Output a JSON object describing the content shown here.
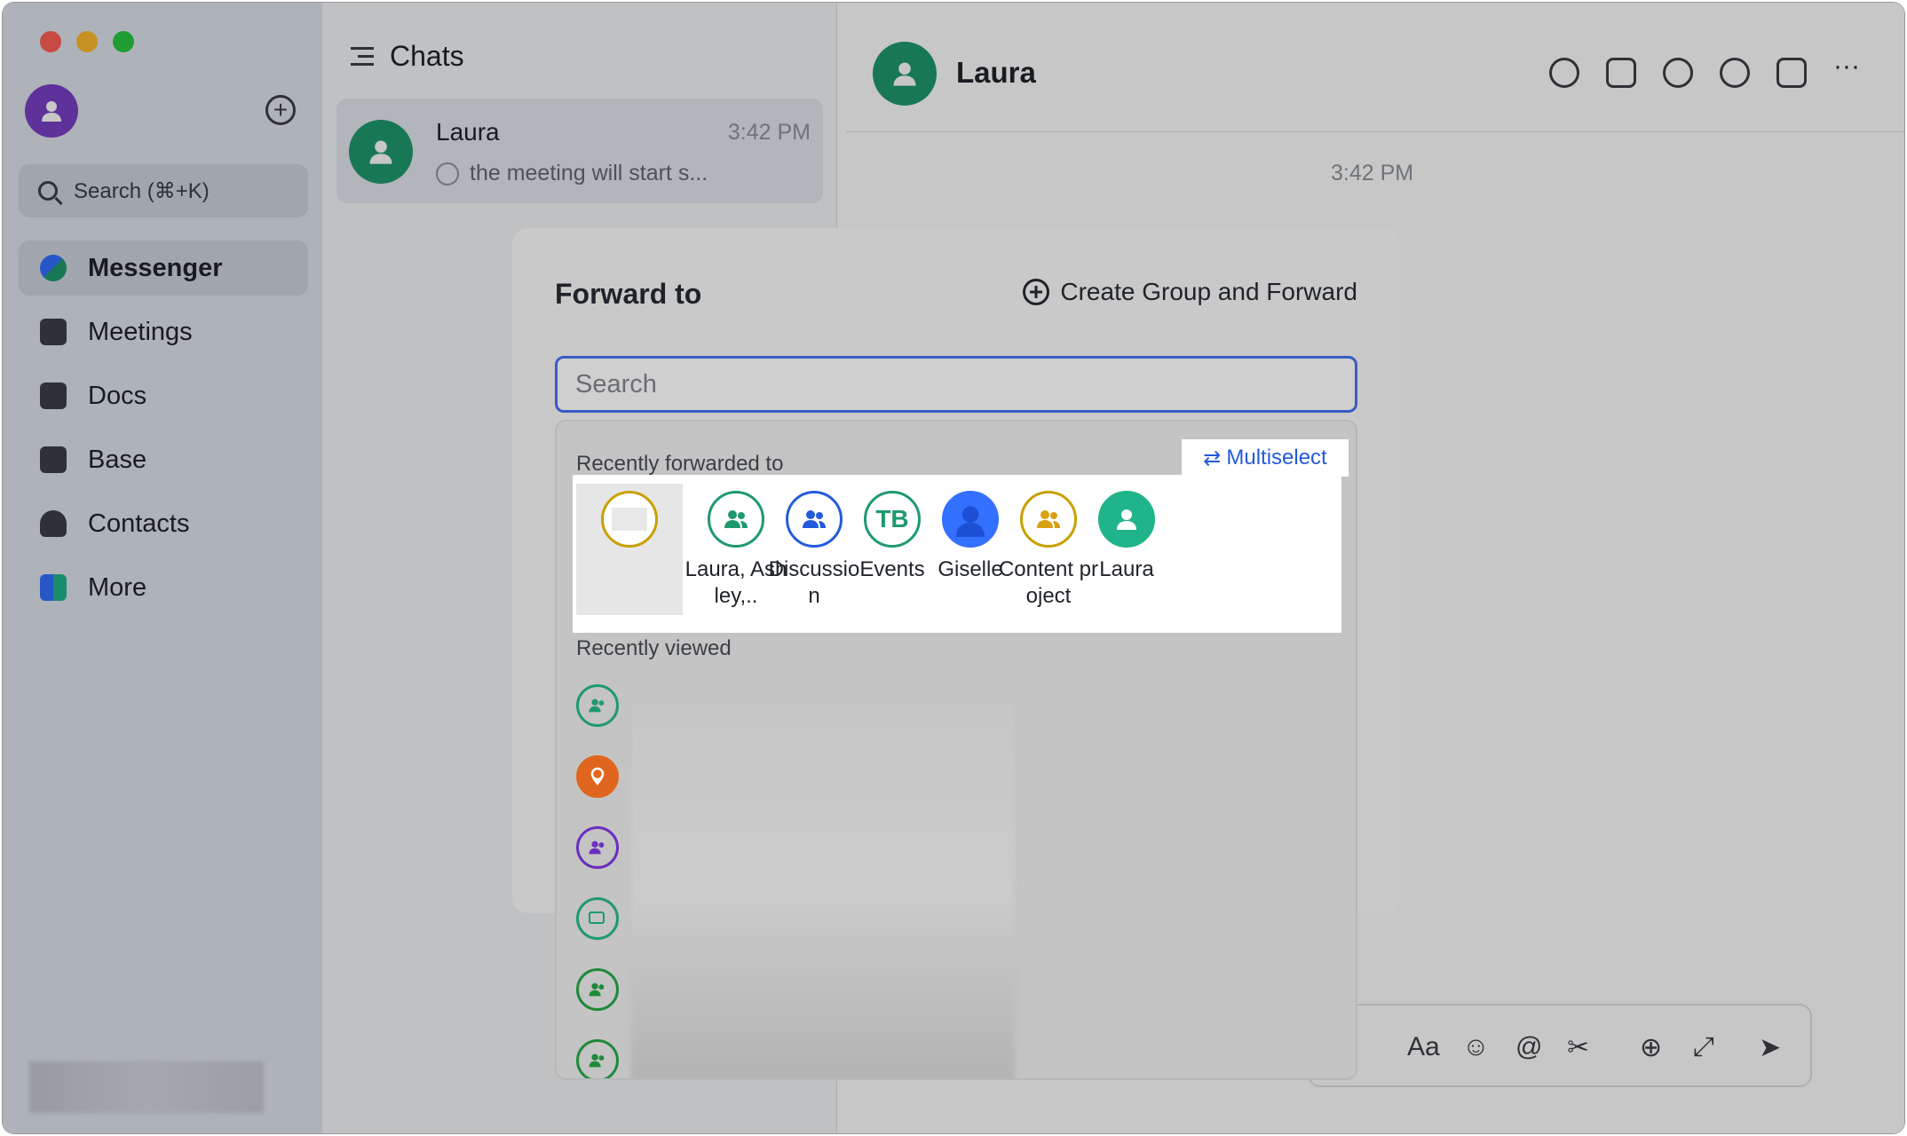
{
  "sidebar": {
    "search_placeholder": "Search (⌘+K)",
    "nav": [
      {
        "label": "Messenger",
        "icon": "messenger-icon",
        "active": true
      },
      {
        "label": "Meetings",
        "icon": "video-camera-icon"
      },
      {
        "label": "Docs",
        "icon": "docs-icon"
      },
      {
        "label": "Base",
        "icon": "base-table-icon"
      },
      {
        "label": "Contacts",
        "icon": "contacts-icon"
      },
      {
        "label": "More",
        "icon": "apps-grid-icon"
      }
    ]
  },
  "chatlist": {
    "title": "Chats",
    "items": [
      {
        "name": "Laura",
        "time": "3:42 PM",
        "preview": "the meeting will start s..."
      }
    ]
  },
  "conversation": {
    "name": "Laura",
    "timestamp": "3:42 PM"
  },
  "modal": {
    "title": "Forward to",
    "create_group_label": "Create Group and Forward",
    "search_placeholder": "Search",
    "recent_forwarded_label": "Recently forwarded to",
    "multiselect_label": "Multiselect",
    "recently_viewed_label": "Recently viewed",
    "recent_forwarded": [
      {
        "label": "",
        "icon": "redacted-avatar-icon",
        "color": "#c9a000"
      },
      {
        "label": "Laura, Ashley,..",
        "icon": "group-icon",
        "color": "#1f9a6d"
      },
      {
        "label": "Discussion",
        "icon": "group-icon",
        "color": "#245bdb"
      },
      {
        "label": "Events",
        "icon": "initials-avatar",
        "initials": "TB",
        "color": "#1f9a6d"
      },
      {
        "label": "Giselle",
        "icon": "person-photo-icon",
        "color": "#3370ff"
      },
      {
        "label": "Content project",
        "icon": "group-icon",
        "color": "#c9a000"
      },
      {
        "label": "Laura",
        "icon": "person-icon",
        "color": "#20b48a"
      }
    ],
    "recently_viewed_icons": [
      {
        "icon": "group-icon",
        "color": "#1f9a6d"
      },
      {
        "icon": "location-person-icon",
        "color": "#e0661f"
      },
      {
        "icon": "group-icon",
        "color": "#6b2fbf"
      },
      {
        "icon": "topic-group-icon",
        "color": "#1f9a6d"
      },
      {
        "icon": "group-icon",
        "color": "#1f8a3a"
      },
      {
        "icon": "group-icon",
        "color": "#1f8a3a"
      }
    ]
  }
}
